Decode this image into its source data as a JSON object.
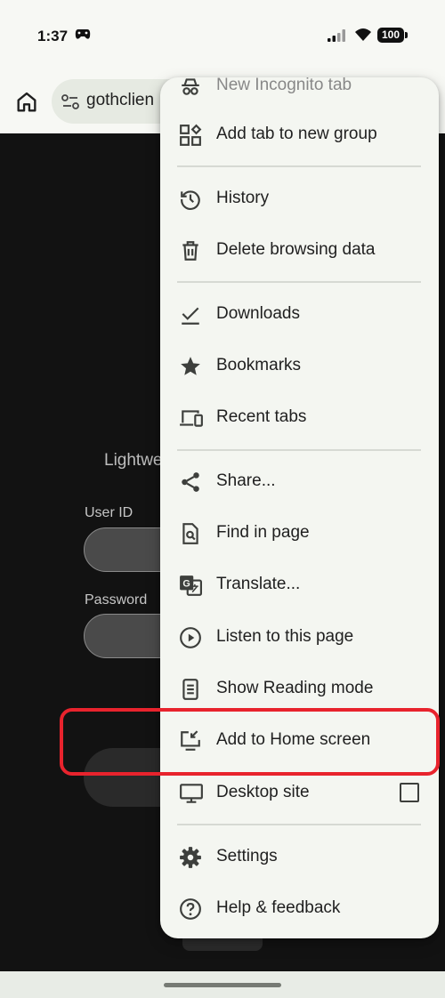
{
  "status_bar": {
    "time": "1:37",
    "battery": "100"
  },
  "omnibox": {
    "text": "gothclien"
  },
  "page": {
    "heading_fragment": "Lightwe",
    "user_id_label": "User ID",
    "password_label": "Password"
  },
  "menu": {
    "items": [
      {
        "label": "New Incognito tab",
        "icon": "incognito-icon"
      },
      {
        "label": "Add tab to new group",
        "icon": "tab-group-icon"
      },
      {
        "label": "History",
        "icon": "history-icon"
      },
      {
        "label": "Delete browsing data",
        "icon": "trash-icon"
      },
      {
        "label": "Downloads",
        "icon": "download-check-icon"
      },
      {
        "label": "Bookmarks",
        "icon": "star-icon"
      },
      {
        "label": "Recent tabs",
        "icon": "devices-icon"
      },
      {
        "label": "Share...",
        "icon": "share-icon"
      },
      {
        "label": "Find in page",
        "icon": "find-in-page-icon"
      },
      {
        "label": "Translate...",
        "icon": "translate-icon"
      },
      {
        "label": "Listen to this page",
        "icon": "play-circle-icon"
      },
      {
        "label": "Show Reading mode",
        "icon": "reading-mode-icon"
      },
      {
        "label": "Add to Home screen",
        "icon": "add-to-home-icon"
      },
      {
        "label": "Desktop site",
        "icon": "monitor-icon",
        "checked": false
      },
      {
        "label": "Settings",
        "icon": "gear-icon"
      },
      {
        "label": "Help & feedback",
        "icon": "help-icon"
      }
    ]
  },
  "colors": {
    "highlight": "#e8232d",
    "page_background": "#121212",
    "menu_background": "#f4f6f1"
  }
}
